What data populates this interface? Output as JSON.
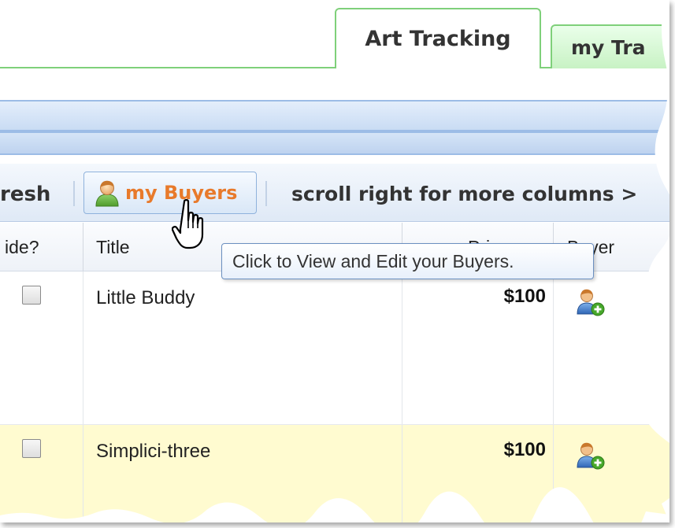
{
  "tabs": [
    {
      "label": "Art Tracking",
      "active": true
    },
    {
      "label": "my Tra",
      "active": false
    }
  ],
  "toolbar": {
    "refresh_label": "resh",
    "buyers_label": "my Buyers",
    "scroll_hint": "scroll right for more columns >"
  },
  "tooltip": "Click to View and Edit your Buyers.",
  "grid": {
    "columns": [
      "ide?",
      "Title",
      "Pri",
      "Buyer"
    ],
    "rows": [
      {
        "title": "Little Buddy",
        "price": "$100"
      },
      {
        "title": "Simplici-three",
        "price": "$100"
      }
    ]
  },
  "colors": {
    "tab_border": "#7fd07a",
    "accent_orange": "#e87a2b",
    "band_blue": "#c9dcf4",
    "row_highlight": "#fffbd0"
  },
  "icons": [
    "user-icon",
    "add-user-icon",
    "hand-cursor-icon"
  ]
}
